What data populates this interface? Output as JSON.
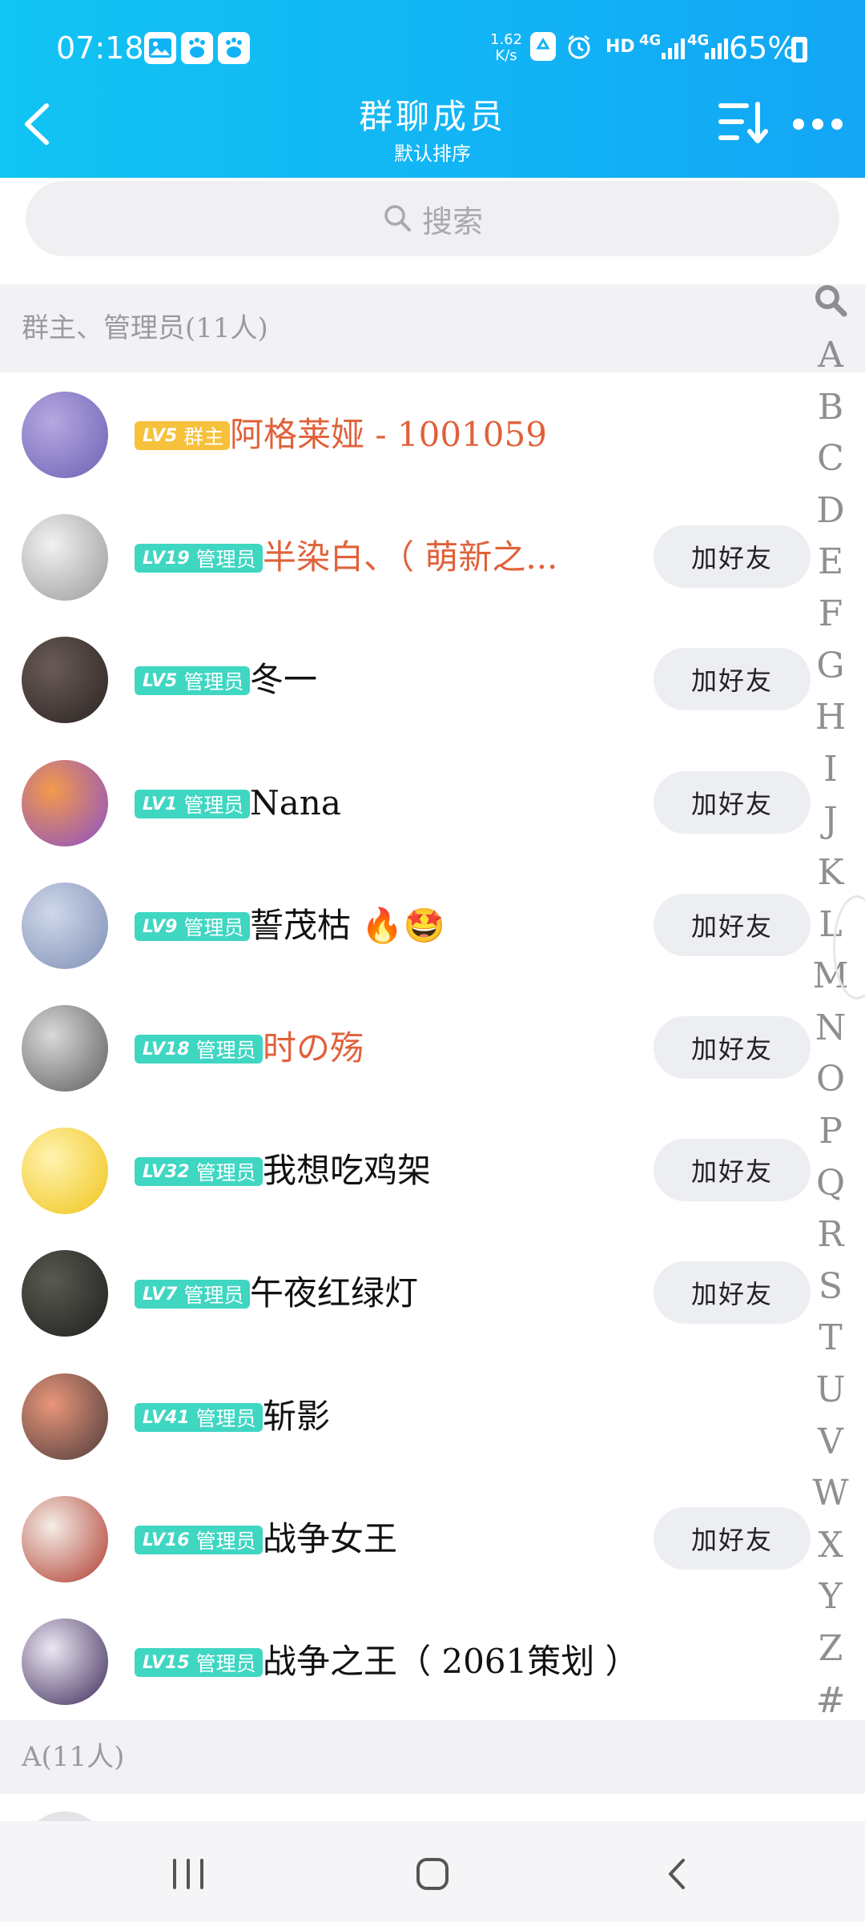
{
  "status_bar": {
    "time": "07:18",
    "net_speed_value": "1.62",
    "net_speed_unit": "K/s",
    "hd_label": "HD",
    "lte_label": "4G",
    "lte_label_2": "4G",
    "battery_percent": "65%",
    "notification_icons": [
      "gallery-icon",
      "baidu-icon",
      "baidu-icon"
    ]
  },
  "header": {
    "title": "群聊成员",
    "subtitle": "默认排序"
  },
  "search": {
    "placeholder": "搜索"
  },
  "sections": {
    "admins_label": "群主、管理员(11人)",
    "a_label": "A(11人)"
  },
  "add_friend_label": "加好友",
  "members": [
    {
      "level": "LV5",
      "role": "群主",
      "name": "阿格莱娅 - 1001059",
      "name_color": "red",
      "add_button": false,
      "avatar_colors": [
        "#b7a7e0",
        "#6b62b5"
      ]
    },
    {
      "level": "LV19",
      "role": "管理员",
      "name": "半染白、（ 萌新之...",
      "name_color": "red",
      "add_button": true,
      "avatar_colors": [
        "#f1f1f1",
        "#9a9a9a"
      ]
    },
    {
      "level": "LV5",
      "role": "管理员",
      "name": "冬一",
      "name_color": "dark",
      "add_button": true,
      "avatar_colors": [
        "#6b5b57",
        "#2a2422"
      ]
    },
    {
      "level": "LV1",
      "role": "管理员",
      "name": "Nana",
      "name_color": "dark",
      "add_button": true,
      "avatar_colors": [
        "#f39a4b",
        "#8a4fc8"
      ]
    },
    {
      "level": "LV9",
      "role": "管理员",
      "name": "誓茂枯 🔥🤩",
      "name_color": "dark",
      "add_button": true,
      "avatar_colors": [
        "#cfd8ea",
        "#7f8fb5"
      ]
    },
    {
      "level": "LV18",
      "role": "管理员",
      "name": "时の殇",
      "name_color": "red",
      "add_button": true,
      "avatar_colors": [
        "#d9d9d9",
        "#5d5d5d"
      ]
    },
    {
      "level": "LV32",
      "role": "管理员",
      "name": "我想吃鸡架",
      "name_color": "dark",
      "add_button": true,
      "avatar_colors": [
        "#fff3b0",
        "#f0c419"
      ]
    },
    {
      "level": "LV7",
      "role": "管理员",
      "name": "午夜红绿灯",
      "name_color": "dark",
      "add_button": true,
      "avatar_colors": [
        "#5a5a52",
        "#1e1f1c"
      ]
    },
    {
      "level": "LV41",
      "role": "管理员",
      "name": "斩影",
      "name_color": "dark",
      "add_button": false,
      "avatar_colors": [
        "#e9967a",
        "#4a3a3a"
      ]
    },
    {
      "level": "LV16",
      "role": "管理员",
      "name": "战争女王",
      "name_color": "dark",
      "add_button": true,
      "avatar_colors": [
        "#f4eee6",
        "#b03a2e"
      ]
    },
    {
      "level": "LV15",
      "role": "管理员",
      "name": "战争之王（ 2061策划 ）",
      "name_color": "dark",
      "add_button": false,
      "avatar_colors": [
        "#ece7f2",
        "#3c2a5a"
      ]
    }
  ],
  "index_bar": [
    "A",
    "B",
    "C",
    "D",
    "E",
    "F",
    "G",
    "H",
    "I",
    "J",
    "K",
    "L",
    "M",
    "N",
    "O",
    "P",
    "Q",
    "R",
    "S",
    "T",
    "U",
    "V",
    "W",
    "X",
    "Y",
    "Z",
    "#"
  ],
  "colors": {
    "header_blue": "#12b3f5",
    "owner_badge": "#f6c13b",
    "admin_badge": "#3fd6c2",
    "name_red": "#e0613a",
    "section_bg": "#f2f2f5"
  }
}
